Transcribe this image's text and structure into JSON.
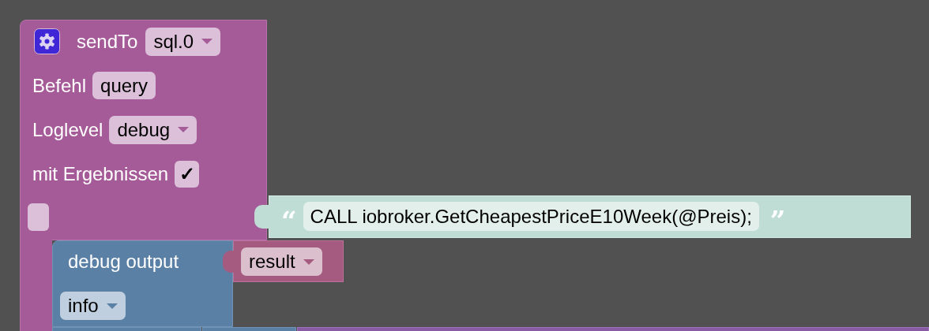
{
  "send_to": {
    "label": "sendTo",
    "instance": "sql.0",
    "command_label": "Befehl",
    "command": "query",
    "loglevel_label": "Loglevel",
    "loglevel": "debug",
    "results_label": "mit Ergebnissen",
    "results_checked": true,
    "check_mark": "✓"
  },
  "query_string": {
    "open_quote": "“",
    "text": "CALL iobroker.GetCheapestPriceE10Week(@Preis);",
    "close_quote": "”"
  },
  "debug_output": {
    "label": "debug output",
    "value": "result",
    "level": "info"
  }
}
